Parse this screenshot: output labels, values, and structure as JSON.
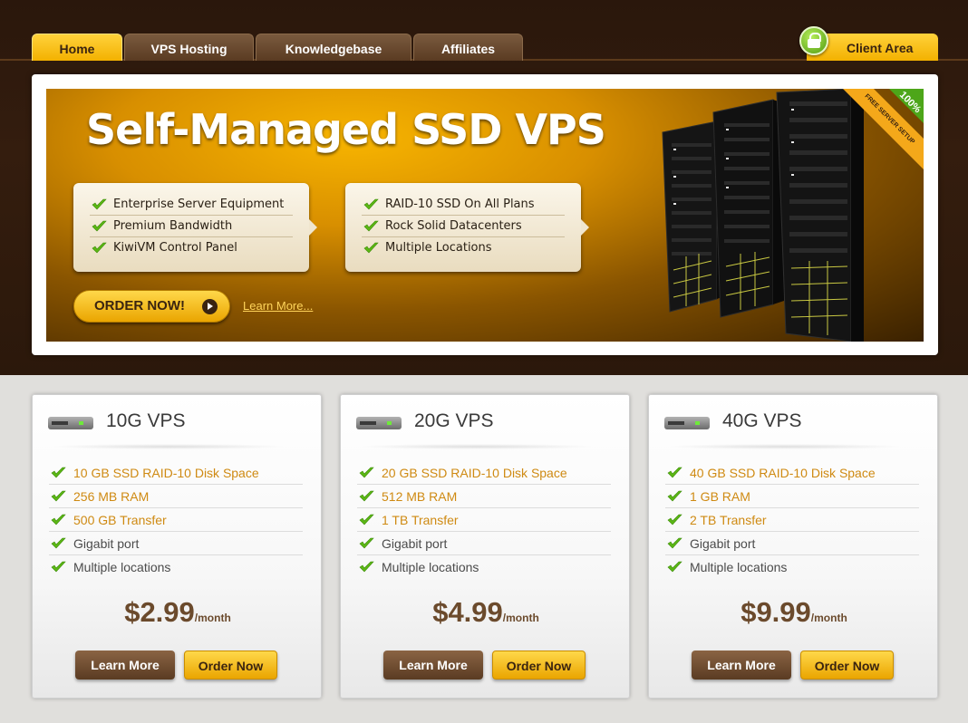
{
  "nav": {
    "tabs": [
      {
        "label": "Home",
        "active": true
      },
      {
        "label": "VPS Hosting",
        "active": false
      },
      {
        "label": "Knowledgebase",
        "active": false
      },
      {
        "label": "Affiliates",
        "active": false
      }
    ],
    "client_area": "Client Area"
  },
  "banner": {
    "title": "Self-Managed SSD VPS",
    "features_left": [
      "Enterprise Server Equipment",
      "Premium Bandwidth",
      "KiwiVM Control Panel"
    ],
    "features_right": [
      "RAID-10 SSD On All Plans",
      "Rock Solid Datacenters",
      "Multiple Locations"
    ],
    "order_button": "ORDER NOW!",
    "learn_more": "Learn More...",
    "ribbon_percent": "100%",
    "ribbon_text": "FREE SERVER SETUP"
  },
  "plans": [
    {
      "title": "10G VPS",
      "features": [
        {
          "text": "10 GB SSD RAID-10 Disk Space",
          "highlight": true
        },
        {
          "text": "256 MB RAM",
          "highlight": true
        },
        {
          "text": "500 GB Transfer",
          "highlight": true
        },
        {
          "text": "Gigabit port",
          "highlight": false
        },
        {
          "text": "Multiple locations",
          "highlight": false
        }
      ],
      "price": "$2.99",
      "period": "/month",
      "learn_label": "Learn More",
      "order_label": "Order Now"
    },
    {
      "title": "20G VPS",
      "features": [
        {
          "text": "20 GB SSD RAID-10 Disk Space",
          "highlight": true
        },
        {
          "text": "512 MB RAM",
          "highlight": true
        },
        {
          "text": "1 TB Transfer",
          "highlight": true
        },
        {
          "text": "Gigabit port",
          "highlight": false
        },
        {
          "text": "Multiple locations",
          "highlight": false
        }
      ],
      "price": "$4.99",
      "period": "/month",
      "learn_label": "Learn More",
      "order_label": "Order Now"
    },
    {
      "title": "40G VPS",
      "features": [
        {
          "text": "40 GB SSD RAID-10 Disk Space",
          "highlight": true
        },
        {
          "text": "1 GB RAM",
          "highlight": true
        },
        {
          "text": "2 TB Transfer",
          "highlight": true
        },
        {
          "text": "Gigabit port",
          "highlight": false
        },
        {
          "text": "Multiple locations",
          "highlight": false
        }
      ],
      "price": "$9.99",
      "period": "/month",
      "learn_label": "Learn More",
      "order_label": "Order Now"
    }
  ],
  "colors": {
    "brand_dark": "#341d0e",
    "accent_gold": "#f3b100",
    "highlight_text": "#cf8a12",
    "check_green": "#5cb814"
  }
}
